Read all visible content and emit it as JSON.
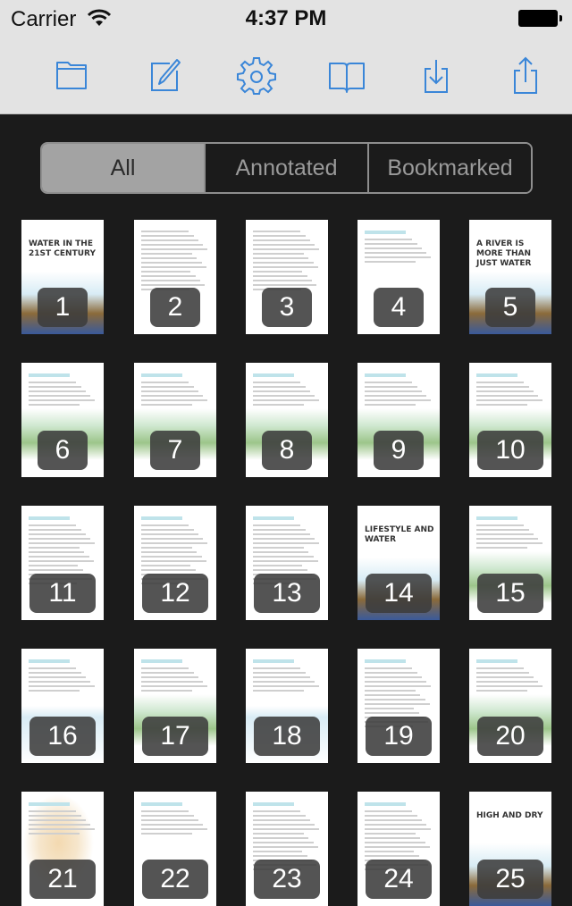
{
  "status_bar": {
    "carrier": "Carrier",
    "time": "4:37 PM",
    "wifi_icon": "wifi-icon",
    "battery_icon": "battery-icon"
  },
  "toolbar": {
    "accent_color": "#3a86d8",
    "buttons": [
      {
        "name": "folder-button",
        "icon": "folder-icon"
      },
      {
        "name": "edit-button",
        "icon": "compose-icon"
      },
      {
        "name": "settings-button",
        "icon": "gear-icon"
      },
      {
        "name": "book-button",
        "icon": "book-icon"
      },
      {
        "name": "download-button",
        "icon": "download-icon"
      },
      {
        "name": "share-button",
        "icon": "share-icon"
      }
    ]
  },
  "filter": {
    "segments": [
      "All",
      "Annotated",
      "Bookmarked"
    ],
    "selected": "All"
  },
  "pages": [
    {
      "number": "1",
      "type": "cover",
      "title": "WATER IN THE 21ST CENTURY"
    },
    {
      "number": "2",
      "type": "text"
    },
    {
      "number": "3",
      "type": "text"
    },
    {
      "number": "4",
      "type": "contents"
    },
    {
      "number": "5",
      "type": "cover",
      "title": "A RIVER IS MORE THAN JUST WATER"
    },
    {
      "number": "6",
      "type": "illustrated"
    },
    {
      "number": "7",
      "type": "illustrated"
    },
    {
      "number": "8",
      "type": "illustrated"
    },
    {
      "number": "9",
      "type": "illustrated"
    },
    {
      "number": "10",
      "type": "illustrated"
    },
    {
      "number": "11",
      "type": "text"
    },
    {
      "number": "12",
      "type": "text"
    },
    {
      "number": "13",
      "type": "text"
    },
    {
      "number": "14",
      "type": "cover",
      "title": "LIFESTYLE AND WATER"
    },
    {
      "number": "15",
      "type": "illustrated"
    },
    {
      "number": "16",
      "type": "chart"
    },
    {
      "number": "17",
      "type": "illustrated"
    },
    {
      "number": "18",
      "type": "chart"
    },
    {
      "number": "19",
      "type": "text"
    },
    {
      "number": "20",
      "type": "illustrated"
    },
    {
      "number": "21",
      "type": "map"
    },
    {
      "number": "22",
      "type": "table"
    },
    {
      "number": "23",
      "type": "text"
    },
    {
      "number": "24",
      "type": "text"
    },
    {
      "number": "25",
      "type": "cover",
      "title": "HIGH AND DRY"
    }
  ]
}
